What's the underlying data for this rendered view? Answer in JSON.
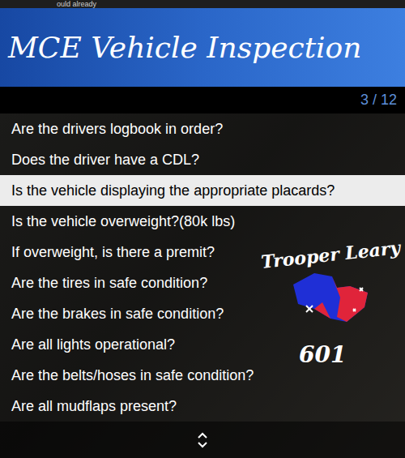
{
  "top_strip": {
    "text": "ould already"
  },
  "banner": {
    "title": "MCE Vehicle Inspection"
  },
  "counter": "3 / 12",
  "items": [
    {
      "label": "Are the drivers logbook in order?",
      "selected": false
    },
    {
      "label": "Does the driver have a CDL?",
      "selected": false
    },
    {
      "label": "Is the vehicle displaying the appropriate placards?",
      "selected": true
    },
    {
      "label": "Is the vehicle overweight?(80k lbs)",
      "selected": false
    },
    {
      "label": "If overweight, is there a premit?",
      "selected": false
    },
    {
      "label": "Are the tires in safe condition?",
      "selected": false
    },
    {
      "label": "Are the brakes in safe condition?",
      "selected": false
    },
    {
      "label": "Are all lights operational?",
      "selected": false
    },
    {
      "label": "Are the belts/hoses in safe condition?",
      "selected": false
    },
    {
      "label": "Are all mudflaps present?",
      "selected": false
    }
  ],
  "watermark": {
    "name": "Trooper Leary",
    "number": "601"
  }
}
